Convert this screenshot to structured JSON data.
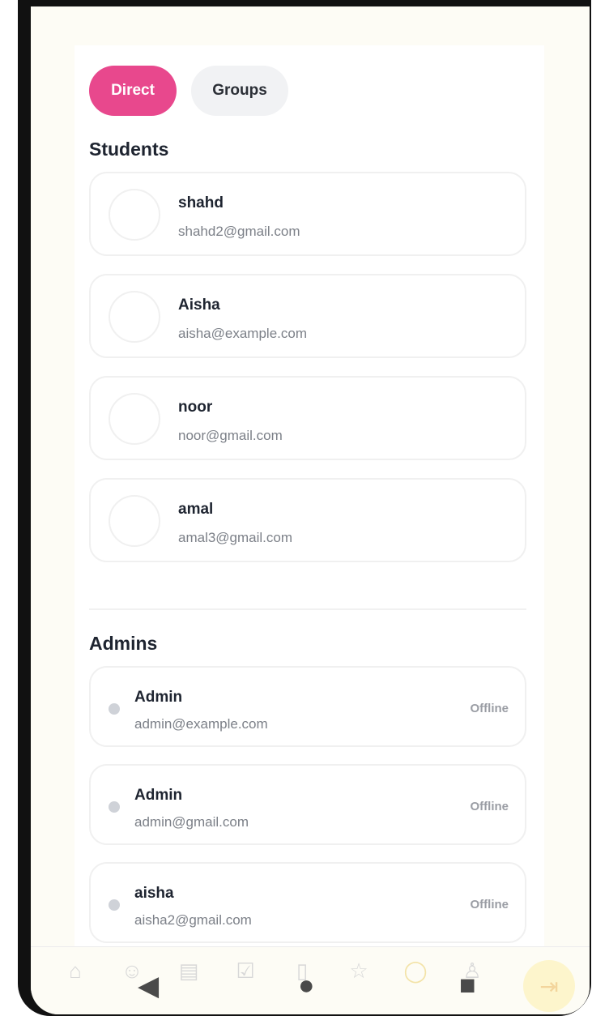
{
  "tabs": [
    {
      "label": "Direct",
      "active": true
    },
    {
      "label": "Groups",
      "active": false
    }
  ],
  "students": {
    "title": "Students",
    "items": [
      {
        "name": "shahd",
        "email": "shahd2@gmail.com"
      },
      {
        "name": "Aisha",
        "email": "aisha@example.com"
      },
      {
        "name": "noor",
        "email": "noor@gmail.com"
      },
      {
        "name": "amal",
        "email": "amal3@gmail.com"
      }
    ]
  },
  "admins": {
    "title": "Admins",
    "items": [
      {
        "name": "Admin",
        "email": "admin@example.com",
        "status": "Offline"
      },
      {
        "name": "Admin",
        "email": "admin@gmail.com",
        "status": "Offline"
      },
      {
        "name": "aisha",
        "email": "aisha2@gmail.com",
        "status": "Offline"
      }
    ]
  },
  "bottom_nav": {
    "icons": [
      "home-icon",
      "users-icon",
      "document-icon",
      "checkbox-icon",
      "clipboard-icon",
      "star-icon",
      "chat-icon",
      "person-icon"
    ],
    "active_icon": "chat-icon",
    "fab_icon": "logout-icon"
  },
  "system_nav": {
    "icons": [
      "back-icon",
      "home-icon",
      "recents-icon"
    ]
  },
  "colors": {
    "accent": "#e8488d",
    "status_dot": "#cfd2d8"
  }
}
